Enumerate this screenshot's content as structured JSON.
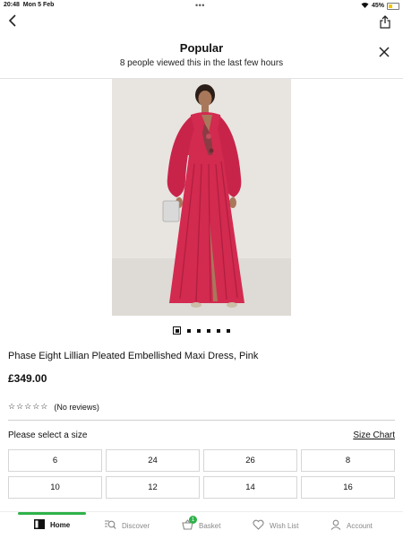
{
  "status_bar": {
    "time": "20:48",
    "date": "Mon 5 Feb",
    "battery": "45%"
  },
  "header": {
    "title": "Popular",
    "subtitle": "8 people viewed this in the last few hours"
  },
  "product": {
    "name": "Phase Eight Lillian Pleated Embellished Maxi Dress, Pink",
    "price": "£349.00",
    "rating": 0,
    "reviews_text": "(No reviews)",
    "image_index": 1,
    "image_count": 6,
    "dress_color": "#d32a4f"
  },
  "sizes": {
    "label": "Please select a size",
    "chart_link": "Size Chart",
    "options": [
      "6",
      "24",
      "26",
      "8",
      "10",
      "12",
      "14",
      "16"
    ]
  },
  "tabbar": {
    "home": "Home",
    "discover": "Discover",
    "basket": "Basket",
    "basket_count": "1",
    "wishlist": "Wish List",
    "account": "Account",
    "accent": "#2fb24a"
  }
}
